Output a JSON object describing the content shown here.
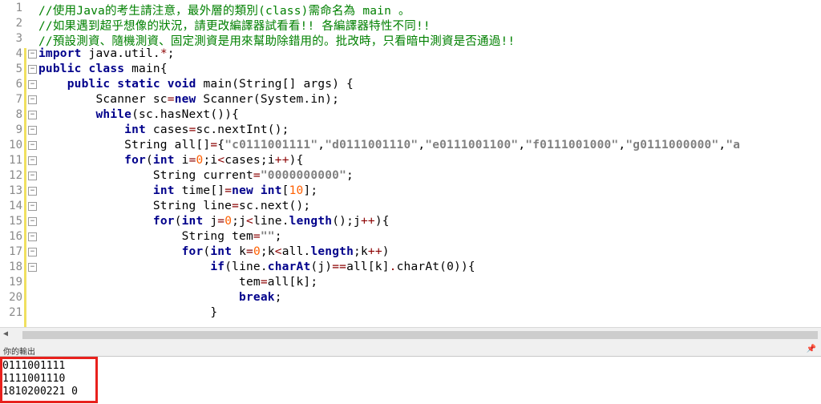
{
  "editor": {
    "line_numbers": [
      "1",
      "2",
      "3",
      "4",
      "5",
      "6",
      "7",
      "8",
      "9",
      "10",
      "11",
      "12",
      "13",
      "14",
      "15",
      "16",
      "17",
      "18",
      "19",
      "20",
      "21"
    ],
    "lines": [
      [
        {
          "t": "//使用Java的考生請注意，最外層的類別(class)需命名為 main 。",
          "c": "cm"
        }
      ],
      [
        {
          "t": "//如果遇到超乎想像的狀況，請更改編譯器試看看!! 各編譯器特性不同!!",
          "c": "cm"
        }
      ],
      [
        {
          "t": "//預設測資、隨機測資、固定測資是用來幫助除錯用的。批改時，只看暗中測資是否通過!!",
          "c": "cm"
        }
      ],
      [
        {
          "t": "import",
          "c": "kw"
        },
        {
          "t": " java.util."
        },
        {
          "t": "*",
          "c": "op"
        },
        {
          "t": ";"
        }
      ],
      [
        {
          "t": "public",
          "c": "kw"
        },
        {
          "t": " "
        },
        {
          "t": "class",
          "c": "kw"
        },
        {
          "t": " main{"
        }
      ],
      [
        {
          "t": "    "
        },
        {
          "t": "public",
          "c": "kw"
        },
        {
          "t": " "
        },
        {
          "t": "static",
          "c": "kw"
        },
        {
          "t": " "
        },
        {
          "t": "void",
          "c": "kw"
        },
        {
          "t": " main(String[] args) {"
        }
      ],
      [
        {
          "t": "        Scanner sc"
        },
        {
          "t": "=",
          "c": "op"
        },
        {
          "t": "new",
          "c": "kw"
        },
        {
          "t": " Scanner(System.in);"
        }
      ],
      [
        {
          "t": "        "
        },
        {
          "t": "while",
          "c": "kw"
        },
        {
          "t": "(sc.hasNext()){"
        }
      ],
      [
        {
          "t": "            "
        },
        {
          "t": "int",
          "c": "kw"
        },
        {
          "t": " cases"
        },
        {
          "t": "=",
          "c": "op"
        },
        {
          "t": "sc.nextInt();"
        }
      ],
      [
        {
          "t": "            String all[]"
        },
        {
          "t": "=",
          "c": "op"
        },
        {
          "t": "{"
        },
        {
          "t": "\"c0111001111\"",
          "c": "st"
        },
        {
          "t": ","
        },
        {
          "t": "\"d0111001110\"",
          "c": "st"
        },
        {
          "t": ","
        },
        {
          "t": "\"e0111001100\"",
          "c": "st"
        },
        {
          "t": ","
        },
        {
          "t": "\"f0111001000\"",
          "c": "st"
        },
        {
          "t": ","
        },
        {
          "t": "\"g0111000000\"",
          "c": "st"
        },
        {
          "t": ","
        },
        {
          "t": "\"a",
          "c": "st"
        }
      ],
      [
        {
          "t": "            "
        },
        {
          "t": "for",
          "c": "kw"
        },
        {
          "t": "("
        },
        {
          "t": "int",
          "c": "kw"
        },
        {
          "t": " i"
        },
        {
          "t": "=",
          "c": "op"
        },
        {
          "t": "0",
          "c": "nm"
        },
        {
          "t": ";i"
        },
        {
          "t": "<",
          "c": "op"
        },
        {
          "t": "cases;i"
        },
        {
          "t": "++",
          "c": "op"
        },
        {
          "t": "){"
        }
      ],
      [
        {
          "t": "                String current"
        },
        {
          "t": "=",
          "c": "op"
        },
        {
          "t": "\"0000000000\"",
          "c": "st"
        },
        {
          "t": ";"
        }
      ],
      [
        {
          "t": "                "
        },
        {
          "t": "int",
          "c": "kw"
        },
        {
          "t": " time[]"
        },
        {
          "t": "=",
          "c": "op"
        },
        {
          "t": "new",
          "c": "kw"
        },
        {
          "t": " "
        },
        {
          "t": "int",
          "c": "kw"
        },
        {
          "t": "["
        },
        {
          "t": "10",
          "c": "nm"
        },
        {
          "t": "];"
        }
      ],
      [
        {
          "t": "                String line"
        },
        {
          "t": "=",
          "c": "op"
        },
        {
          "t": "sc.next();"
        }
      ],
      [
        {
          "t": "                "
        },
        {
          "t": "for",
          "c": "kw"
        },
        {
          "t": "("
        },
        {
          "t": "int",
          "c": "kw"
        },
        {
          "t": " j"
        },
        {
          "t": "=",
          "c": "op"
        },
        {
          "t": "0",
          "c": "nm"
        },
        {
          "t": ";j"
        },
        {
          "t": "<",
          "c": "op"
        },
        {
          "t": "line."
        },
        {
          "t": "length",
          "c": "kw"
        },
        {
          "t": "();j"
        },
        {
          "t": "++",
          "c": "op"
        },
        {
          "t": "){"
        }
      ],
      [
        {
          "t": "                    String tem"
        },
        {
          "t": "=",
          "c": "op"
        },
        {
          "t": "\"\"",
          "c": "st"
        },
        {
          "t": ";"
        }
      ],
      [
        {
          "t": "                    "
        },
        {
          "t": "for",
          "c": "kw"
        },
        {
          "t": "("
        },
        {
          "t": "int",
          "c": "kw"
        },
        {
          "t": " k"
        },
        {
          "t": "=",
          "c": "op"
        },
        {
          "t": "0",
          "c": "nm"
        },
        {
          "t": ";k"
        },
        {
          "t": "<",
          "c": "op"
        },
        {
          "t": "all."
        },
        {
          "t": "length",
          "c": "kw"
        },
        {
          "t": ";k"
        },
        {
          "t": "++",
          "c": "op"
        },
        {
          "t": ")"
        }
      ],
      [
        {
          "t": "                        "
        },
        {
          "t": "if",
          "c": "kw"
        },
        {
          "t": "(line."
        },
        {
          "t": "charAt",
          "c": "kw"
        },
        {
          "t": "(j)"
        },
        {
          "t": "==",
          "c": "op"
        },
        {
          "t": "all[k]"
        },
        {
          "t": ".",
          "c": "op"
        },
        {
          "t": "charAt(0)){"
        }
      ],
      [
        {
          "t": "                            tem"
        },
        {
          "t": "=",
          "c": "op"
        },
        {
          "t": "all[k];"
        }
      ],
      [
        {
          "t": "                            "
        },
        {
          "t": "break",
          "c": "kw"
        },
        {
          "t": ";"
        }
      ],
      [
        {
          "t": "                        }"
        }
      ]
    ],
    "fold_markers": {
      "3": "⊟",
      "4": "⊟",
      "5": "⊟",
      "6": "⊟",
      "7": "⊟",
      "8": "⊟",
      "9": "⊟",
      "10": "⊟",
      "11": "⊟",
      "12": "⊟",
      "13": "⊟",
      "14": "⊟",
      "15": "⊟",
      "16": "⊟",
      "17": "⊟"
    }
  },
  "output_panel": {
    "title": "你的輸出",
    "pin_icon": "pin-icon",
    "lines": [
      "0111001111",
      "1111001110",
      "1810200221 0"
    ]
  },
  "colors": {
    "highlight_box": "#e8211d",
    "comment": "#008000",
    "keyword": "#00008b"
  }
}
